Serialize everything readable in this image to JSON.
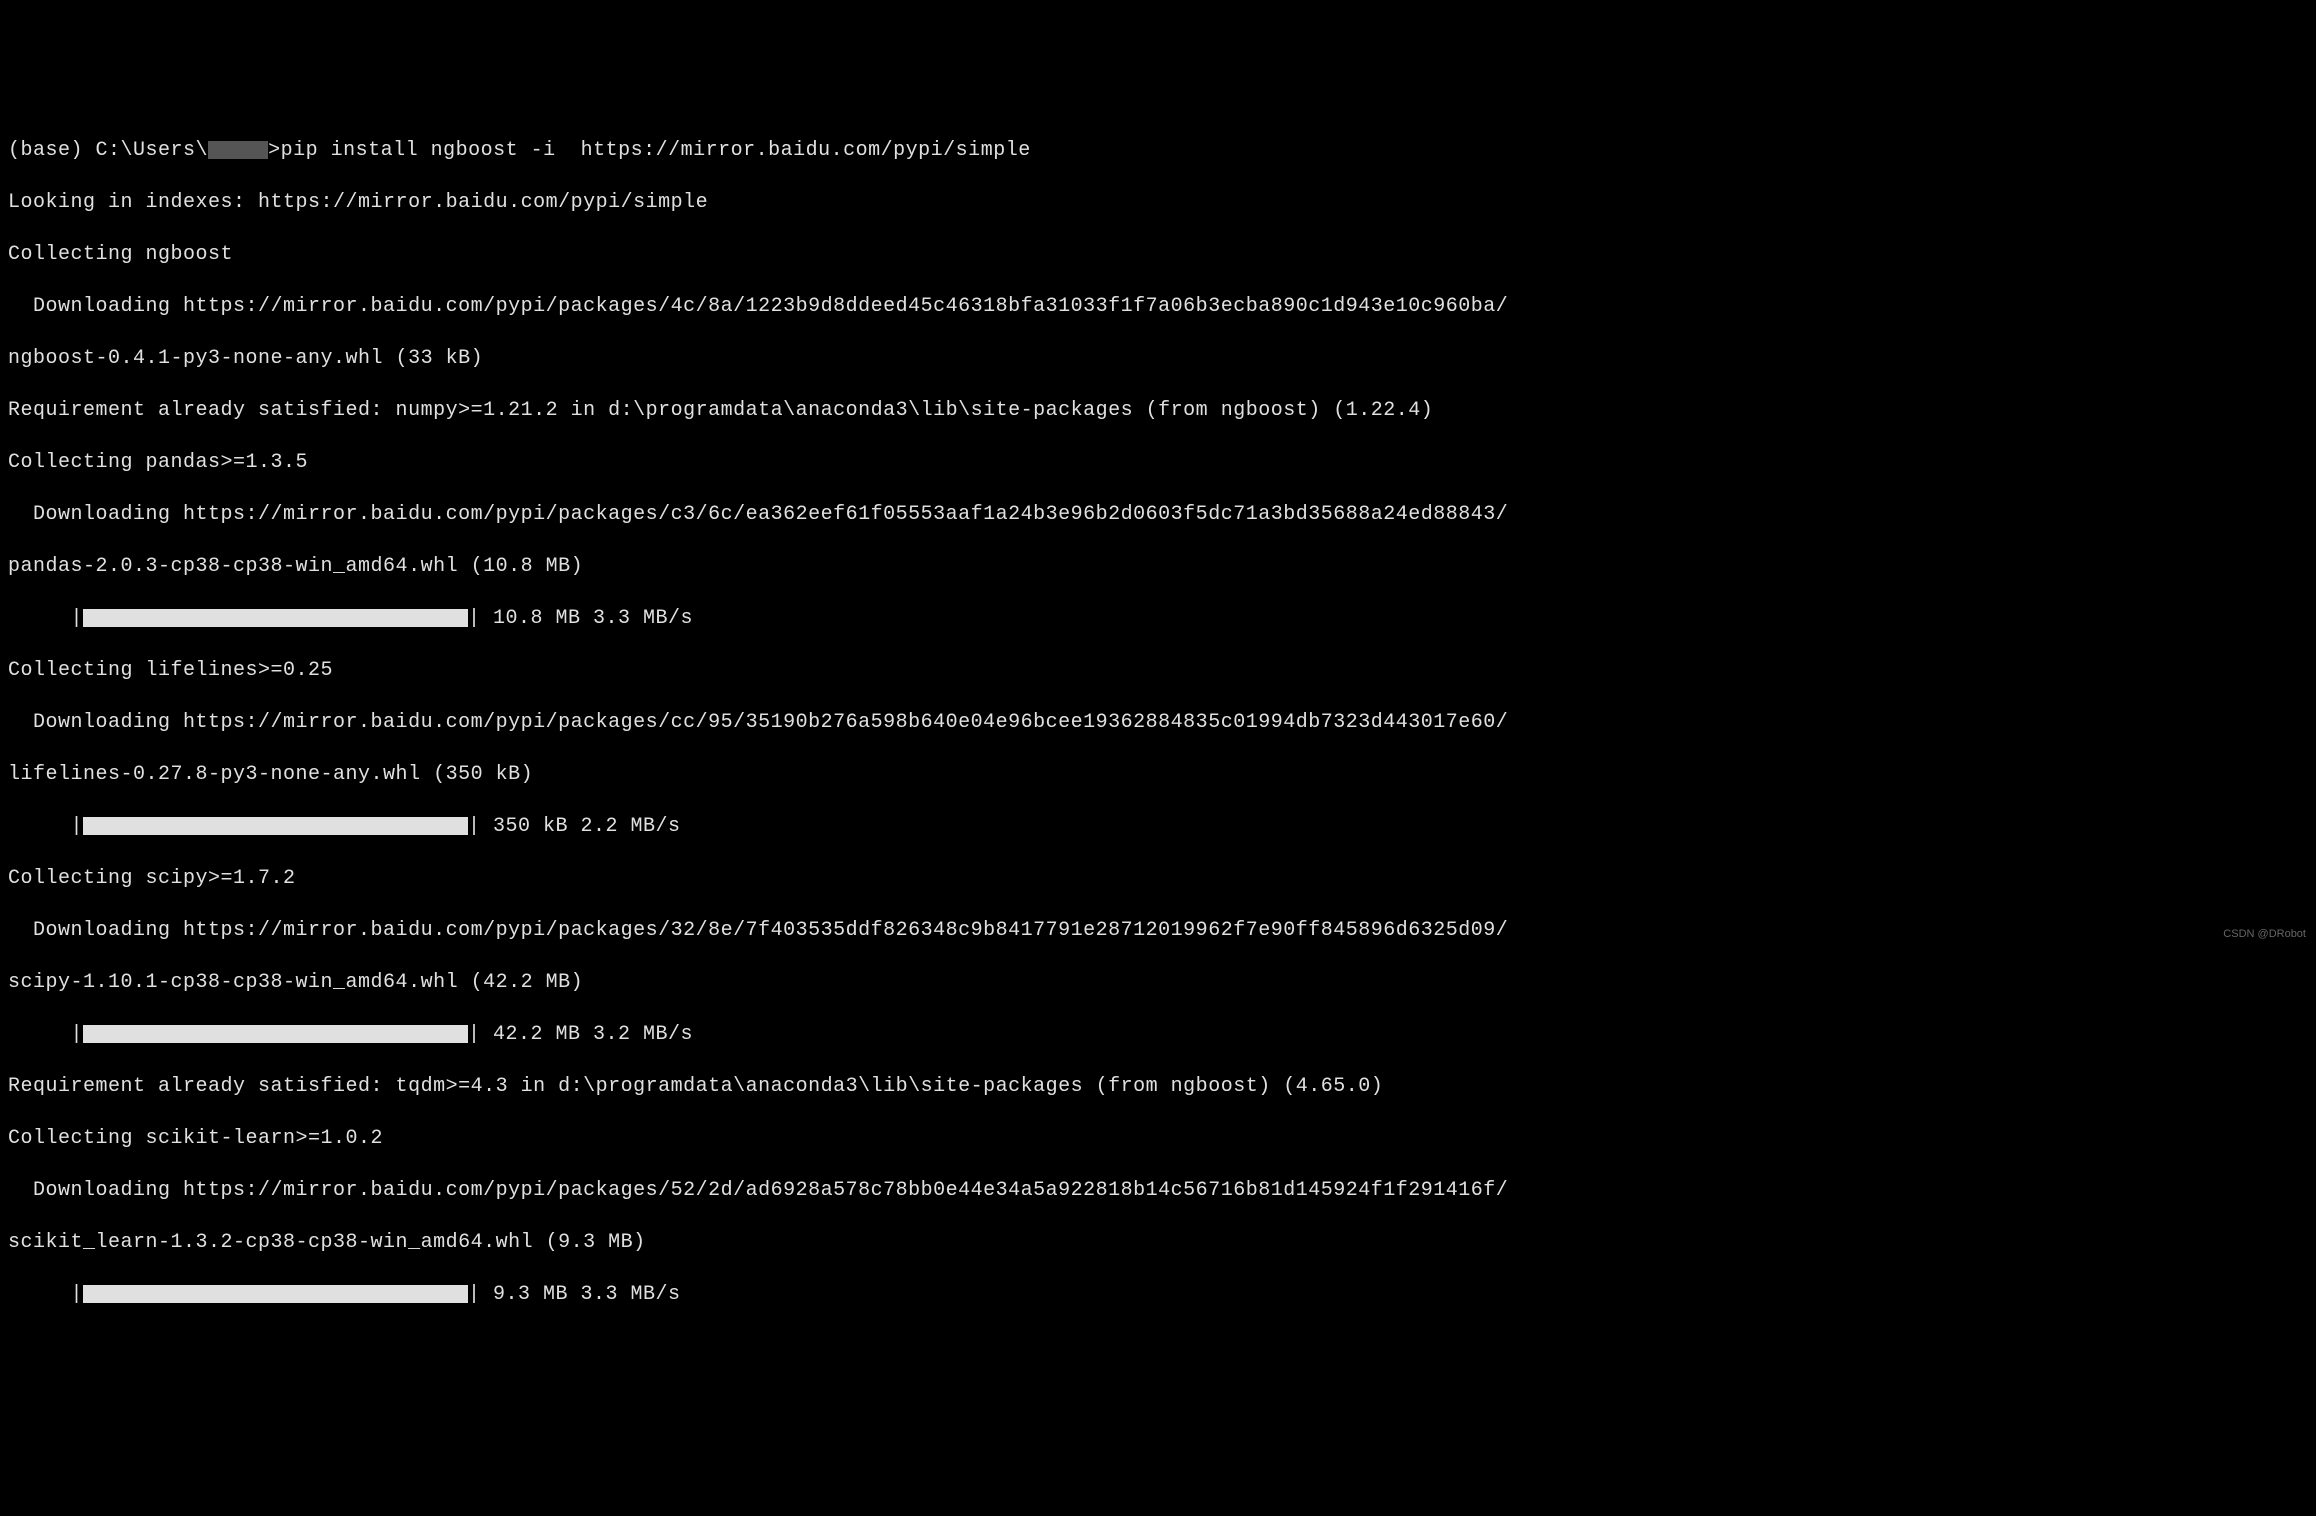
{
  "prompt": {
    "env": "(base)",
    "path_prefix": "C:\\Users\\",
    "path_suffix": ">",
    "command": "pip install ngboost -i  https://mirror.baidu.com/pypi/simple"
  },
  "lines": {
    "looking": "Looking in indexes: https://mirror.baidu.com/pypi/simple",
    "collecting_ngboost": "Collecting ngboost",
    "download_ngboost_url": "  Downloading https://mirror.baidu.com/pypi/packages/4c/8a/1223b9d8ddeed45c46318bfa31033f1f7a06b3ecba890c1d943e10c960ba/",
    "download_ngboost_file": "ngboost-0.4.1-py3-none-any.whl (33 kB)",
    "req_numpy": "Requirement already satisfied: numpy>=1.21.2 in d:\\programdata\\anaconda3\\lib\\site-packages (from ngboost) (1.22.4)",
    "collecting_pandas": "Collecting pandas>=1.3.5",
    "download_pandas_url": "  Downloading https://mirror.baidu.com/pypi/packages/c3/6c/ea362eef61f05553aaf1a24b3e96b2d0603f5dc71a3bd35688a24ed88843/",
    "download_pandas_file": "pandas-2.0.3-cp38-cp38-win_amd64.whl (10.8 MB)",
    "progress_pandas_prefix": "     |",
    "progress_pandas_suffix": "| 10.8 MB 3.3 MB/s",
    "collecting_lifelines": "Collecting lifelines>=0.25",
    "download_lifelines_url": "  Downloading https://mirror.baidu.com/pypi/packages/cc/95/35190b276a598b640e04e96bcee19362884835c01994db7323d443017e60/",
    "download_lifelines_file": "lifelines-0.27.8-py3-none-any.whl (350 kB)",
    "progress_lifelines_prefix": "     |",
    "progress_lifelines_suffix": "| 350 kB 2.2 MB/s",
    "collecting_scipy": "Collecting scipy>=1.7.2",
    "download_scipy_url": "  Downloading https://mirror.baidu.com/pypi/packages/32/8e/7f403535ddf826348c9b8417791e28712019962f7e90ff845896d6325d09/",
    "download_scipy_file": "scipy-1.10.1-cp38-cp38-win_amd64.whl (42.2 MB)",
    "progress_scipy_prefix": "     |",
    "progress_scipy_suffix": "| 42.2 MB 3.2 MB/s",
    "req_tqdm": "Requirement already satisfied: tqdm>=4.3 in d:\\programdata\\anaconda3\\lib\\site-packages (from ngboost) (4.65.0)",
    "collecting_sklearn": "Collecting scikit-learn>=1.0.2",
    "download_sklearn_url": "  Downloading https://mirror.baidu.com/pypi/packages/52/2d/ad6928a578c78bb0e44e34a5a922818b14c56716b81d145924f1f291416f/",
    "download_sklearn_file": "scikit_learn-1.3.2-cp38-cp38-win_amd64.whl (9.3 MB)",
    "progress_sklearn_prefix": "     |",
    "progress_sklearn_suffix": "| 9.3 MB 3.3 MB/s"
  },
  "watermark": "CSDN @DRobot"
}
